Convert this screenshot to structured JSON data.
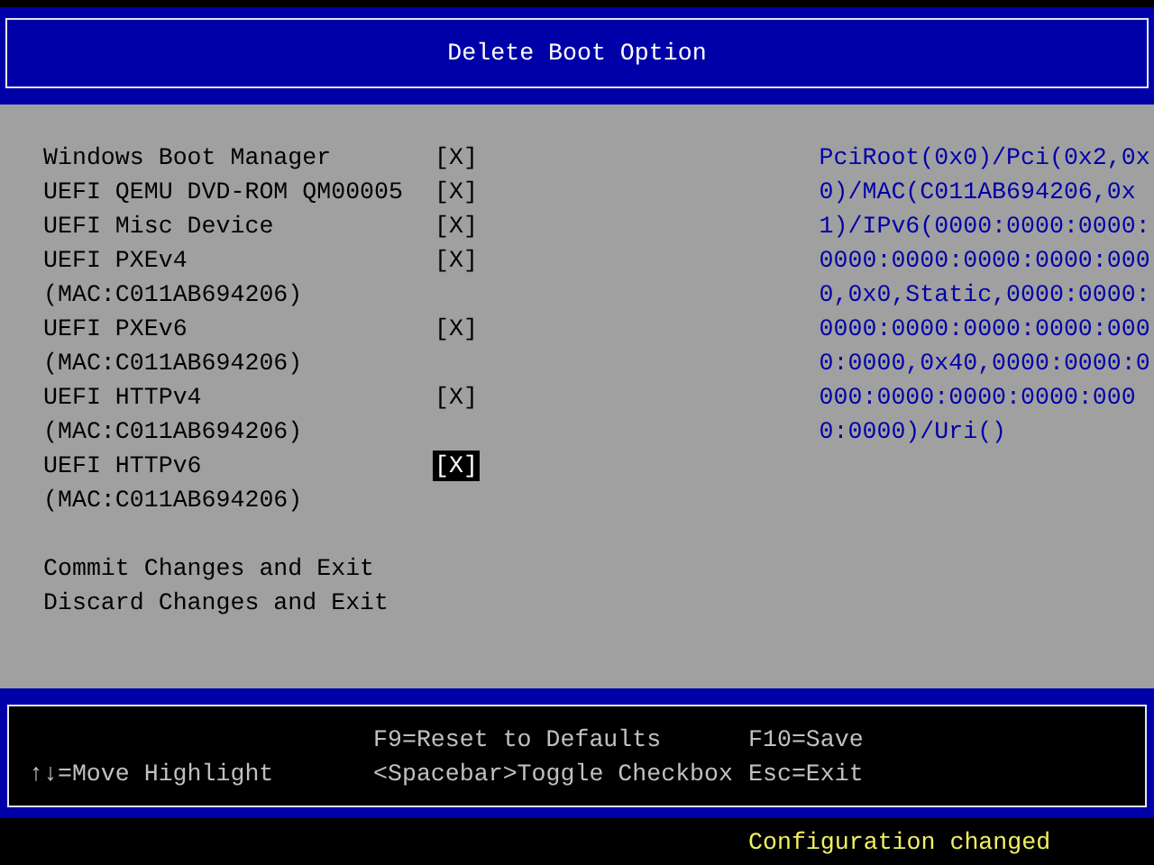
{
  "title": "Delete Boot Option",
  "options": [
    {
      "label": "Windows Boot Manager",
      "checkbox": "[X]",
      "selected": false
    },
    {
      "label": "UEFI QEMU DVD-ROM QM00005",
      "checkbox": "[X]",
      "selected": false
    },
    {
      "label": "UEFI Misc Device",
      "checkbox": "[X]",
      "selected": false
    },
    {
      "label": "UEFI PXEv4",
      "sublabel": "(MAC:C011AB694206)",
      "checkbox": "[X]",
      "selected": false
    },
    {
      "label": "UEFI PXEv6",
      "sublabel": "(MAC:C011AB694206)",
      "checkbox": "[X]",
      "selected": false
    },
    {
      "label": "UEFI HTTPv4",
      "sublabel": "(MAC:C011AB694206)",
      "checkbox": "[X]",
      "selected": false
    },
    {
      "label": "UEFI HTTPv6",
      "sublabel": "(MAC:C011AB694206)",
      "checkbox": "[X]",
      "selected": true
    }
  ],
  "actions": [
    "Commit Changes and Exit",
    "Discard Changes and Exit"
  ],
  "help_text": "PciRoot(0x0)/Pci(0x2,0x0)/MAC(C011AB694206,0x1)/IPv6(0000:0000:0000:0000:0000:0000:0000:0000,0x0,Static,0000:0000:0000:0000:0000:0000:0000:0000,0x40,0000:0000:0000:0000:0000:0000:0000:0000)/Uri()",
  "key_help": {
    "left": [
      "↑↓=Move Highlight"
    ],
    "middle": [
      "F9=Reset to Defaults",
      "<Spacebar>Toggle Checkbox"
    ],
    "right": [
      "F10=Save",
      "Esc=Exit"
    ]
  },
  "status": "Configuration changed"
}
